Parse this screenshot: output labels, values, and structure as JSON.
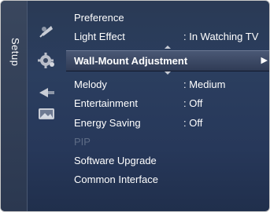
{
  "sidebar": {
    "label": "Setup"
  },
  "menu": {
    "items": [
      {
        "label": "Preference",
        "value": ""
      },
      {
        "label": "Light Effect",
        "value": ": In Watching TV"
      },
      {
        "label": "Wall-Mount Adjustment",
        "value": "▶",
        "selected": true
      },
      {
        "label": "Melody",
        "value": ": Medium"
      },
      {
        "label": "Entertainment",
        "value": ": Off"
      },
      {
        "label": "Energy Saving",
        "value": ": Off"
      },
      {
        "label": "PIP",
        "value": "",
        "disabled": true
      },
      {
        "label": "Software Upgrade",
        "value": ""
      },
      {
        "label": "Common Interface",
        "value": ""
      }
    ]
  },
  "icons": [
    "satellite-icon",
    "gear-icon",
    "input-icon",
    "picture-icon"
  ],
  "colors": {
    "panel": "#2b3e5f",
    "highlight": "#3f4d6b",
    "disabled_text": "#5e6c86",
    "text": "#ffffff"
  }
}
